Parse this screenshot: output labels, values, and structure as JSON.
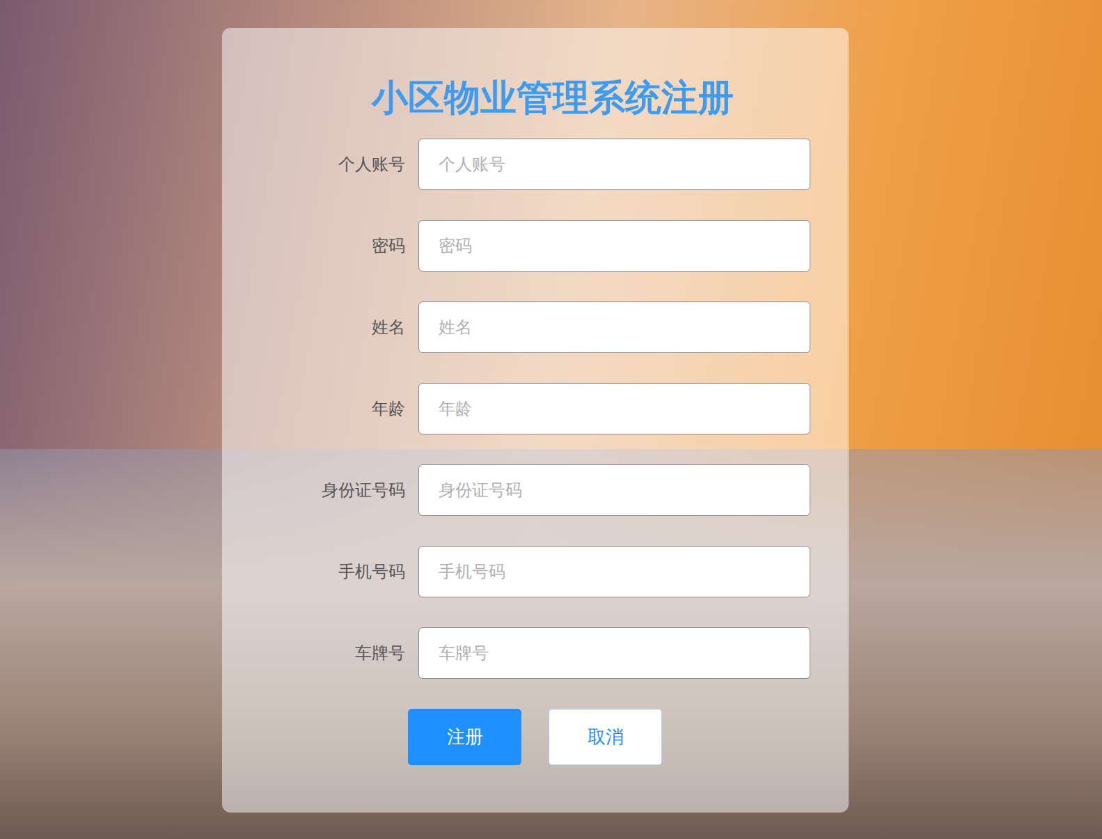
{
  "form": {
    "title": "小区物业管理系统注册",
    "fields": [
      {
        "label": "个人账号",
        "placeholder": "个人账号"
      },
      {
        "label": "密码",
        "placeholder": "密码"
      },
      {
        "label": "姓名",
        "placeholder": "姓名"
      },
      {
        "label": "年龄",
        "placeholder": "年龄"
      },
      {
        "label": "身份证号码",
        "placeholder": "身份证号码"
      },
      {
        "label": "手机号码",
        "placeholder": "手机号码"
      },
      {
        "label": "车牌号",
        "placeholder": "车牌号"
      }
    ],
    "buttons": [
      {
        "label": "注册",
        "kind": "primary"
      },
      {
        "label": "取消",
        "kind": "secondary"
      }
    ]
  }
}
